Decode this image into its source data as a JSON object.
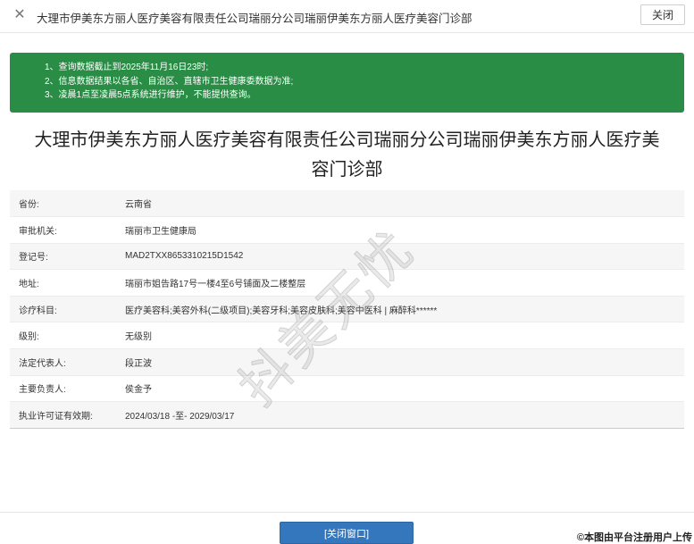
{
  "window": {
    "close_icon": "close-x-icon",
    "title": "大理市伊美东方丽人医疗美容有限责任公司瑞丽分公司瑞丽伊美东方丽人医疗美容门诊部",
    "close_label": "关闭"
  },
  "notice": {
    "lines": [
      "1、查询数据截止到2025年11月16日23时;",
      "2、信息数据结果以各省、自治区、直辖市卫生健康委数据为准;",
      "3、凌晨1点至凌晨5点系统进行维护，不能提供查询。"
    ],
    "color": "#2a8d46"
  },
  "company": {
    "name_line1": "大理市伊美东方丽人医疗美容有限责任公司瑞丽分公司瑞丽伊美东方丽人医疗美",
    "name_line2": "容门诊部"
  },
  "details": [
    {
      "label": "省份:",
      "value": "云南省"
    },
    {
      "label": "审批机关:",
      "value": "瑞丽市卫生健康局"
    },
    {
      "label": "登记号:",
      "value": "MAD2TXX8653310215D1542"
    },
    {
      "label": "地址:",
      "value": "瑞丽市姐告路17号一楼4至6号铺面及二楼整层"
    },
    {
      "label": "诊疗科目:",
      "value": "医疗美容科;美容外科(二级项目);美容牙科;美容皮肤科;美容中医科 | 麻醉科******"
    },
    {
      "label": "级别:",
      "value": "无级别"
    },
    {
      "label": "法定代表人:",
      "value": "段正波"
    },
    {
      "label": "主要负责人:",
      "value": "侯金予"
    },
    {
      "label": "执业许可证有效期:",
      "value": "2024/03/18 -至- 2029/03/17"
    }
  ],
  "watermark": "抖美无忧",
  "footer": {
    "close_window_label": "[关闭窗口]",
    "upload_note": "©本图由平台注册用户上传",
    "button_color": "#3577bd"
  }
}
